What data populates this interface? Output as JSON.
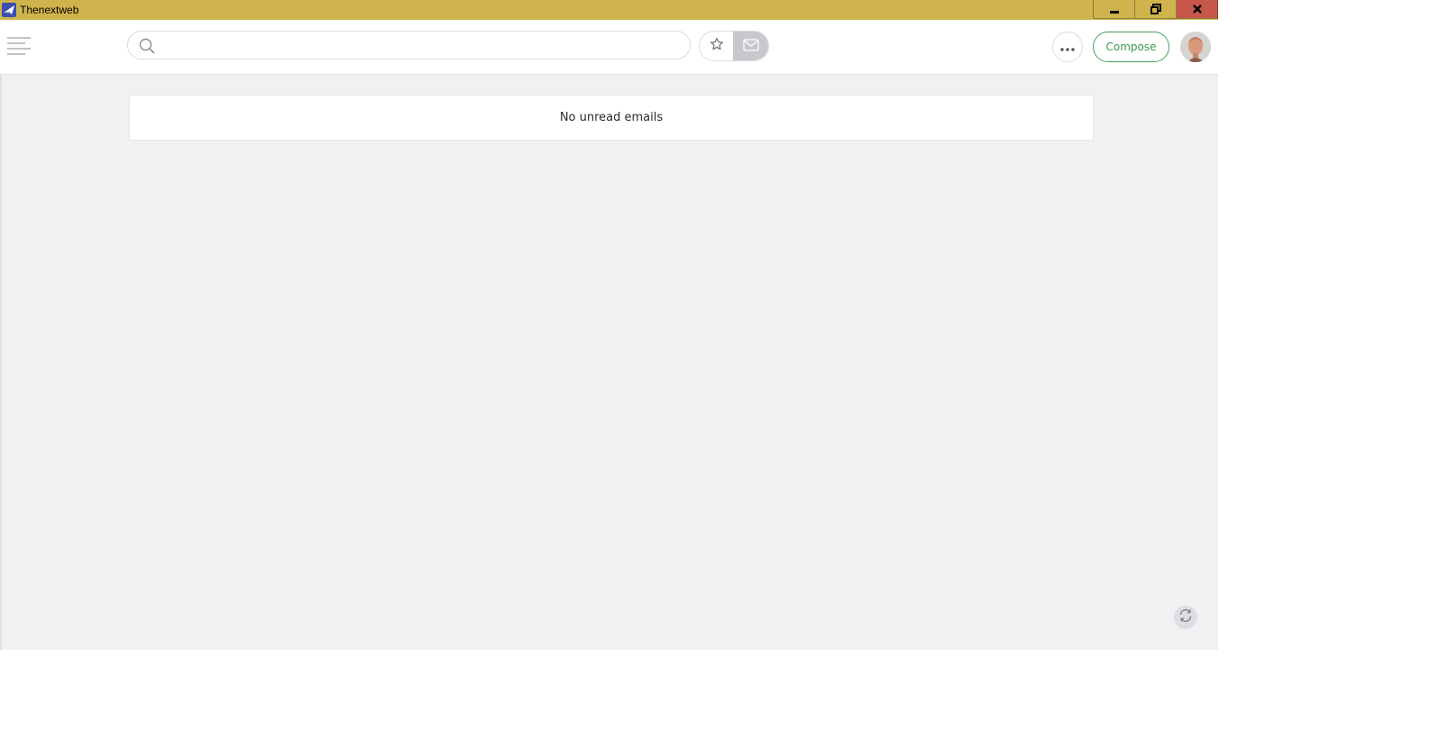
{
  "window": {
    "title": "Thenextweb",
    "titlebar_color": "#cfb44d",
    "close_color": "#c7574b",
    "icons": {
      "app": "paper-plane-icon",
      "minimize": "minimize-icon",
      "maximize": "restore-icon",
      "close": "close-icon"
    }
  },
  "toolbar": {
    "menu_icon": "hamburger-menu-icon",
    "search": {
      "value": "",
      "placeholder": "",
      "icon": "search-icon"
    },
    "filters": [
      {
        "name": "starred",
        "icon": "star-icon",
        "active": false
      },
      {
        "name": "unread",
        "icon": "mail-icon",
        "active": true
      }
    ],
    "more_icon": "more-horizontal-icon",
    "compose_label": "Compose",
    "compose_color": "#3f9a4f",
    "avatar_icon": "user-avatar"
  },
  "main": {
    "empty_message": "No unread emails",
    "background": "#f0f1f3",
    "refresh_icon": "refresh-icon"
  }
}
